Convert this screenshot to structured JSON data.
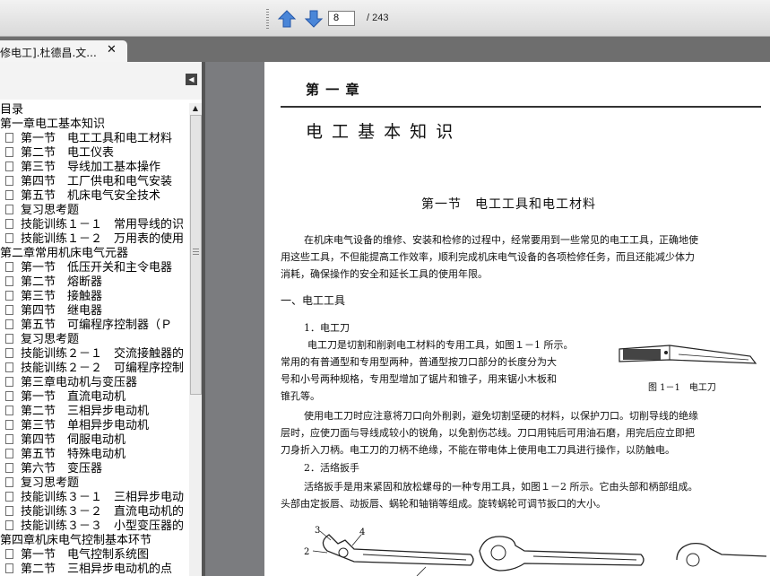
{
  "toolbar": {
    "prev_icon": "up-arrow-icon",
    "next_icon": "down-arrow-icon",
    "page_current": "8",
    "page_total": "/ 243"
  },
  "tab": {
    "title": "修电工].杜德昌.文...",
    "close": "✕"
  },
  "sidebar": {
    "items": [
      {
        "label": "目录",
        "level": 0
      },
      {
        "label": "第一章电工基本知识",
        "level": 0
      },
      {
        "label": "第一节　电工工具和电工材料",
        "level": 1
      },
      {
        "label": "第二节　电工仪表",
        "level": 1
      },
      {
        "label": "第三节　导线加工基本操作",
        "level": 1
      },
      {
        "label": "第四节　工厂供电和电气安装",
        "level": 1
      },
      {
        "label": "第五节　机床电气安全技术",
        "level": 1
      },
      {
        "label": "复习思考题",
        "level": 1
      },
      {
        "label": "技能训练１－１　常用导线的识",
        "level": 1
      },
      {
        "label": "技能训练１－２　万用表的使用",
        "level": 1
      },
      {
        "label": "第二章常用机床电气元器",
        "level": 0
      },
      {
        "label": "第一节　低压开关和主令电器",
        "level": 1
      },
      {
        "label": "第二节　熔断器",
        "level": 1
      },
      {
        "label": "第三节　接触器",
        "level": 1
      },
      {
        "label": "第四节　继电器",
        "level": 1
      },
      {
        "label": "第五节　可编程序控制器（Ｐ",
        "level": 1
      },
      {
        "label": "复习思考题",
        "level": 1
      },
      {
        "label": "技能训练２－１　交流接触器的",
        "level": 1
      },
      {
        "label": "技能训练２－２　可编程序控制",
        "level": 1
      },
      {
        "label": "第三章电动机与变压器",
        "level": 1
      },
      {
        "label": "第一节　直流电动机",
        "level": 1
      },
      {
        "label": "第二节　三相异步电动机",
        "level": 1
      },
      {
        "label": "第三节　单相异步电动机",
        "level": 1
      },
      {
        "label": "第四节　伺服电动机",
        "level": 1
      },
      {
        "label": "第五节　特殊电动机",
        "level": 1
      },
      {
        "label": "第六节　变压器",
        "level": 1
      },
      {
        "label": "复习思考题",
        "level": 1
      },
      {
        "label": "技能训练３－１　三相异步电动",
        "level": 1
      },
      {
        "label": "技能训练３－２　直流电动机的",
        "level": 1
      },
      {
        "label": "技能训练３－３　小型变压器的",
        "level": 1
      },
      {
        "label": "第四章机床电气控制基本环节",
        "level": 0
      },
      {
        "label": "第一节　电气控制系统图",
        "level": 1
      },
      {
        "label": "第二节　三相异步电动机的点",
        "level": 1
      }
    ]
  },
  "document": {
    "chapter_number": "第 一 章",
    "chapter_title": "电 工 基 本 知 识",
    "section_title": "第一节　电工工具和电工材料",
    "intro_lines": [
      "在机床电气设备的维修、安装和检修的过程中，经常要用到一些常见的电工工具，正确地使",
      "用这些工具，不但能提高工作效率，顺利完成机床电气设备的各项检修任务，而且还能减少体力",
      "消耗，确保操作的安全和延长工具的使用年限。"
    ],
    "heading_tools": "一、电工工具",
    "heading_knife": "1．电工刀",
    "knife_lines": [
      "电工刀是切割和削剥电工材料的专用工具，如图１－1 所示。",
      "常用的有普通型和专用型两种，普通型按刀口部分的长度分为大",
      "号和小号两种规格，专用型增加了锯片和锥子，用来锯小木板和",
      "锥孔等。"
    ],
    "figure_caption": "图 1－1　电工刀",
    "knife_usage_lines": [
      "使用电工刀时应注意将刀口向外削剥，避免切割坚硬的材料，以保护刀口。切削导线的绝缘",
      "层时，应使刀面与导线成较小的锐角，以免割伤芯线。刀口用钝后可用油石磨，用完后应立即把",
      "刀身折入刀柄。电工刀的刀柄不绝缘，不能在带电体上使用电工刀具进行操作，以防触电。"
    ],
    "heading_wrench": "2．活络扳手",
    "wrench_lines": [
      "活络扳手是用来紧固和放松螺母的一种专用工具，如图１－2 所示。它由头部和柄部组成。",
      "头部由定扳唇、动扳唇、蜗轮和轴销等组成。旋转蜗轮可调节扳口的大小。"
    ],
    "wrench_labels": [
      "3",
      "4",
      "2",
      "1"
    ]
  }
}
